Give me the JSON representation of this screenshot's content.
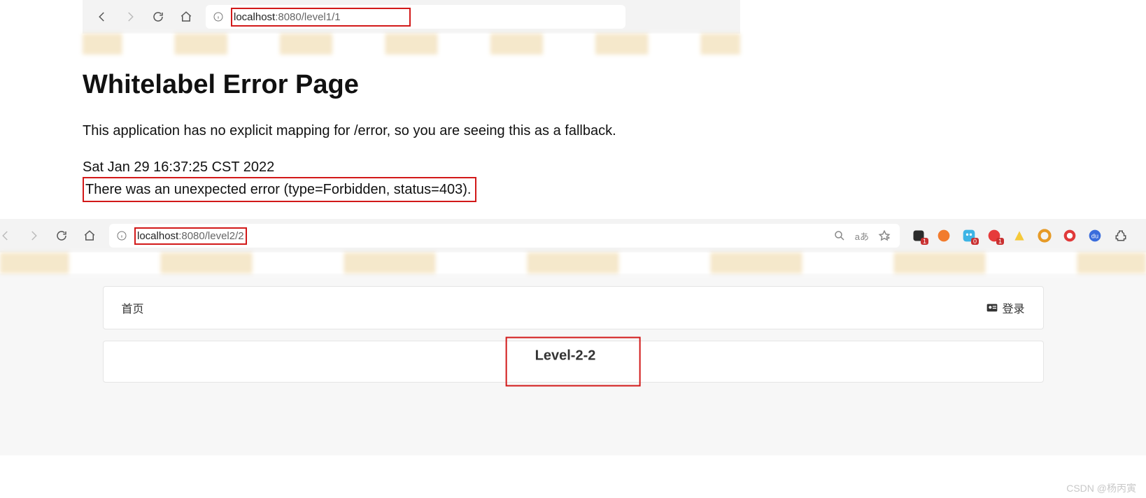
{
  "section1": {
    "url_host": "localhost",
    "url_port": ":8080",
    "url_path": "/level1/1",
    "error": {
      "title": "Whitelabel Error Page",
      "mapping": "This application has no explicit mapping for /error, so you are seeing this as a fallback.",
      "timestamp": "Sat Jan 29 16:37:25 CST 2022",
      "detail": "There was an unexpected error (type=Forbidden, status=403)."
    }
  },
  "section2": {
    "url_host": "localhost",
    "url_port": ":8080",
    "url_path": "/level2/2",
    "aa_text": "aあ",
    "ext_badges": [
      "1",
      "0",
      "1"
    ],
    "header_home": "首页",
    "header_login": "登录",
    "content_title": "Level-2-2"
  },
  "watermark": "CSDN @杨丙寅"
}
